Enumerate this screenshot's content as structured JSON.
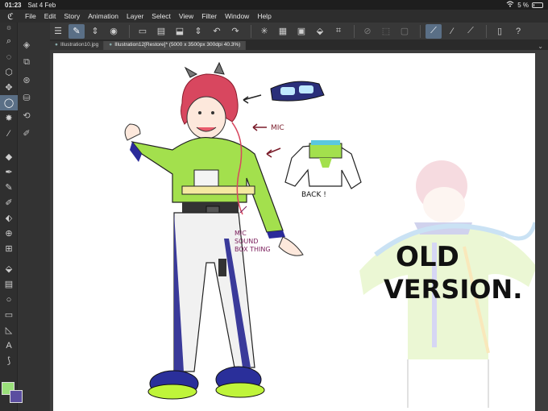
{
  "statusbar": {
    "time": "01:23",
    "date": "Sat 4 Feb",
    "battery": "5 %",
    "battery_level": 0.05
  },
  "menu": {
    "logo_icon": "app-logo-icon",
    "items": [
      "File",
      "Edit",
      "Story",
      "Animation",
      "Layer",
      "Select",
      "View",
      "Filter",
      "Window",
      "Help"
    ]
  },
  "tabs": [
    {
      "label": "Illustration10.jpg"
    },
    {
      "label": "Illustration12[Restore]* (5000 x 3500px 300dpi 40.3%)"
    }
  ],
  "annotations": {
    "mic": "MIC",
    "back": "BACK !",
    "mic_sound_1": "MIC",
    "mic_sound_2": "SOUND",
    "mic_sound_3": "BOX THING",
    "old_version_1": "OLD",
    "old_version_2": "VERSION."
  },
  "colors": {
    "main": "#9ae07a",
    "sub": "#5b4ea0",
    "accent": "#5a6f86"
  }
}
